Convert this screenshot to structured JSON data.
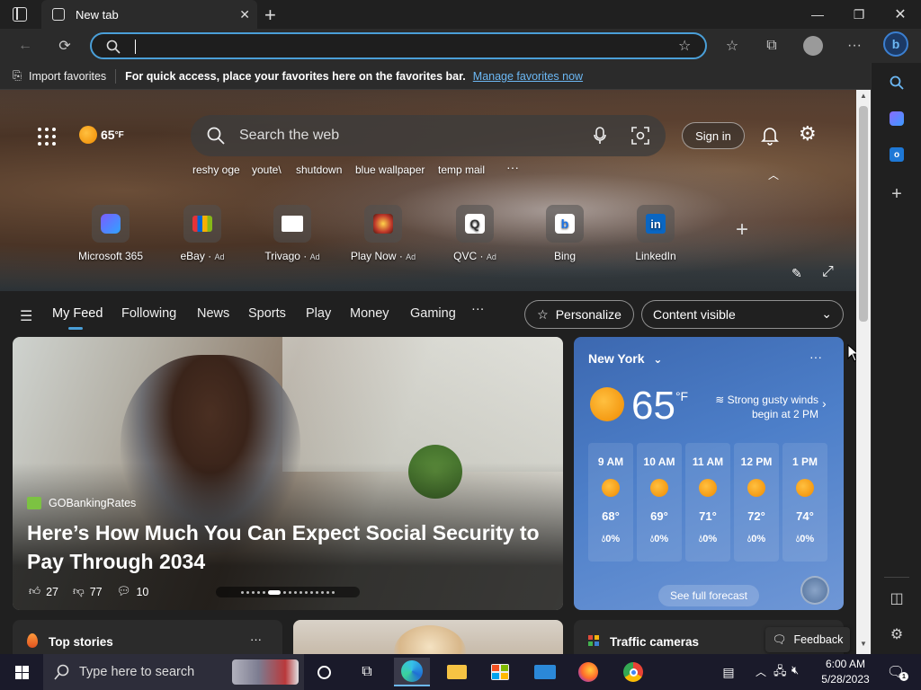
{
  "browser": {
    "tab_title": "New tab",
    "address_value": "",
    "favbar": {
      "import_label": "Import favorites",
      "hint": "For quick access, place your favorites here on the favorites bar.",
      "manage_link": "Manage favorites now"
    }
  },
  "hero": {
    "weather_temp": "65",
    "weather_unit": "°F",
    "search_placeholder": "Search the web",
    "sign_in": "Sign in",
    "trending": [
      "reshy oge",
      "youte\\",
      "shutdown",
      "blue wallpaper",
      "temp mail"
    ],
    "quick_links": [
      {
        "label": "Microsoft 365",
        "ad": ""
      },
      {
        "label": "eBay",
        "ad": "Ad"
      },
      {
        "label": "Trivago",
        "ad": "Ad"
      },
      {
        "label": "Play Now",
        "ad": "Ad"
      },
      {
        "label": "QVC",
        "ad": "Ad"
      },
      {
        "label": "Bing",
        "ad": ""
      },
      {
        "label": "LinkedIn",
        "ad": ""
      }
    ]
  },
  "feed_nav": {
    "items": [
      "My Feed",
      "Following",
      "News",
      "Sports",
      "Play",
      "Money",
      "Gaming"
    ],
    "more": "···",
    "personalize": "Personalize",
    "content_visible": "Content visible"
  },
  "main_story": {
    "source": "GOBankingRates",
    "headline": "Here’s How Much You Can Expect Social Security to Pay Through 2034",
    "likes": "27",
    "dislikes": "77",
    "comments": "10"
  },
  "weather": {
    "city": "New York",
    "temp": "65",
    "unit": "°F",
    "alert": "Strong gusty winds begin at 2 PM",
    "hours": [
      {
        "time": "9 AM",
        "temp": "68°",
        "precip": "0%"
      },
      {
        "time": "10 AM",
        "temp": "69°",
        "precip": "0%"
      },
      {
        "time": "11 AM",
        "temp": "71°",
        "precip": "0%"
      },
      {
        "time": "12 PM",
        "temp": "72°",
        "precip": "0%"
      },
      {
        "time": "1 PM",
        "temp": "74°",
        "precip": "0%"
      }
    ],
    "forecast_button": "See full forecast"
  },
  "bottom": {
    "top_stories": "Top stories",
    "traffic": "Traffic cameras",
    "feedback": "Feedback"
  },
  "taskbar": {
    "search_placeholder": "Type here to search",
    "time": "6:00 AM",
    "date": "5/28/2023"
  },
  "colors": {
    "accent": "#4a9fd8",
    "weather_card": "#4d7fc9",
    "sun": "#f5a000"
  }
}
